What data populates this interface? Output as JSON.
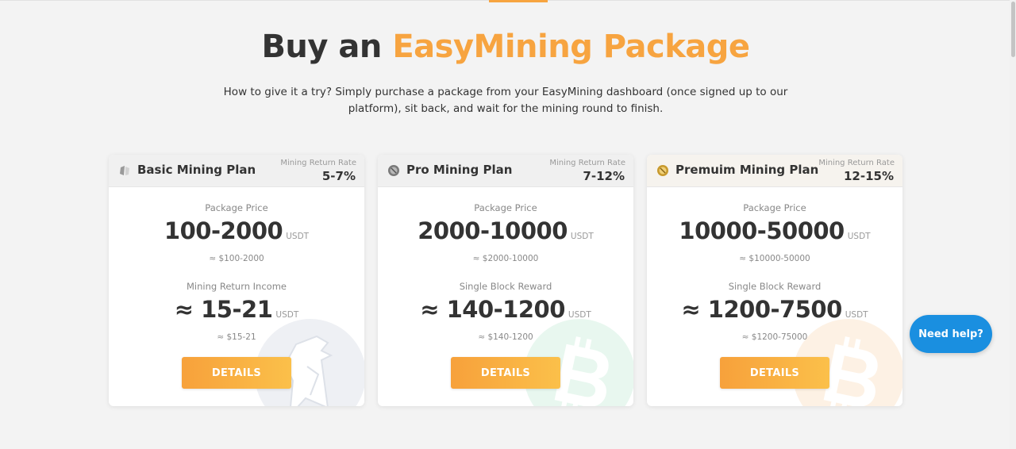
{
  "header": {
    "title_main": "Buy an",
    "title_accent": "EasyMining Package",
    "intro": "How to give it a try? Simply purchase a package from your EasyMining dashboard (once signed up to our platform), sit back, and wait for the mining round to finish."
  },
  "colors": {
    "accent": "#f7a440",
    "help_button": "#1a8fe0",
    "button_gradient_start": "#f7a13b",
    "button_gradient_end": "#fbc04a"
  },
  "plans": [
    {
      "name": "Basic Mining Plan",
      "icon": "silver-coin-icon",
      "rate_label": "Mining Return Rate",
      "rate": "5-7%",
      "price_label": "Package Price",
      "price": "100-2000",
      "price_unit": "USDT",
      "price_usd": "≈ $100-2000",
      "income_label": "Mining Return Income",
      "income": "≈ 15-21",
      "income_unit": "USDT",
      "income_usd": "≈ $15-21",
      "button": "DETAILS",
      "watermark": "eagle-icon"
    },
    {
      "name": "Pro Mining Plan",
      "icon": "gray-coin-icon",
      "rate_label": "Mining Return Rate",
      "rate": "7-12%",
      "price_label": "Package Price",
      "price": "2000-10000",
      "price_unit": "USDT",
      "price_usd": "≈ $2000-10000",
      "income_label": "Single Block Reward",
      "income": "≈ 140-1200",
      "income_unit": "USDT",
      "income_usd": "≈ $140-1200",
      "button": "DETAILS",
      "watermark": "bitcoin-icon"
    },
    {
      "name": "Premuim Mining Plan",
      "icon": "gold-coin-icon",
      "rate_label": "Mining Return Rate",
      "rate": "12-15%",
      "price_label": "Package Price",
      "price": "10000-50000",
      "price_unit": "USDT",
      "price_usd": "≈ $10000-50000",
      "income_label": "Single Block Reward",
      "income": "≈ 1200-7500",
      "income_unit": "USDT",
      "income_usd": "≈ $1200-75000",
      "button": "DETAILS",
      "watermark": "bitcoin-icon"
    }
  ],
  "help_button": "Need help?"
}
